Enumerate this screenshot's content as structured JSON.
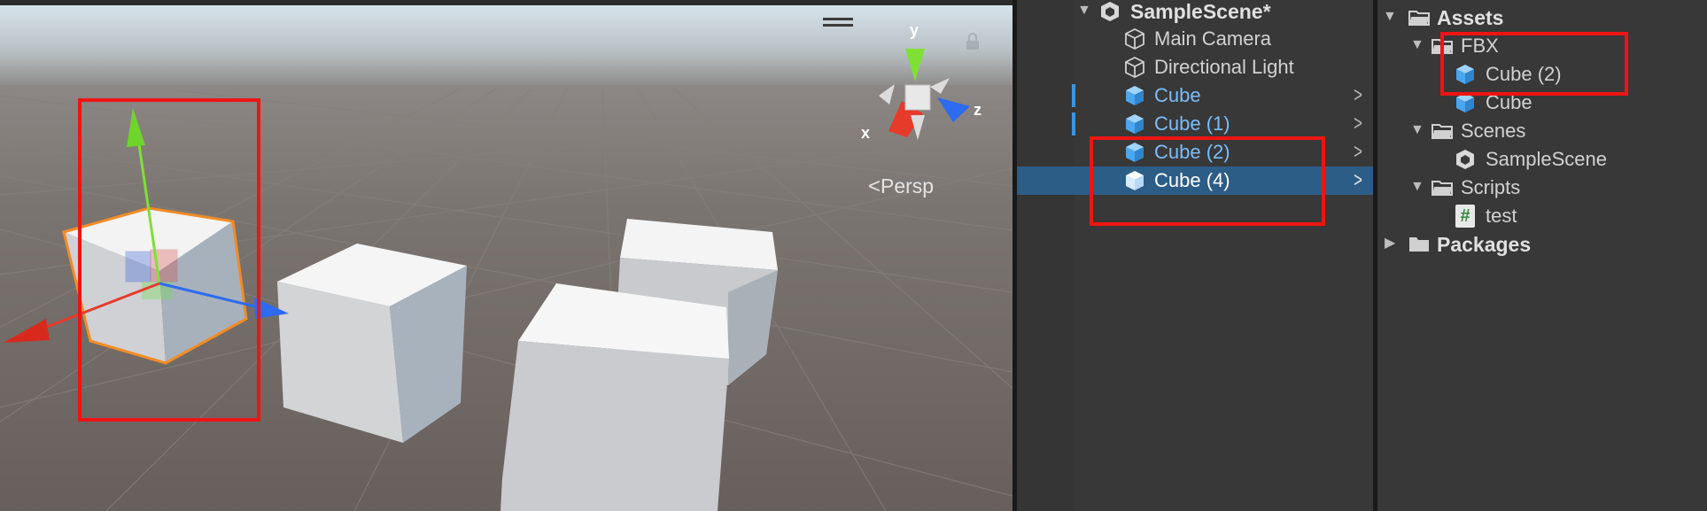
{
  "colors": {
    "panel_bg": "#383838",
    "selection": "#2c5d87",
    "prefab_text": "#7cbdf7",
    "annotation": "#ef1414",
    "axis_x": "#e63a2a",
    "axis_y": "#7ee034",
    "axis_z": "#2d6bf0"
  },
  "scene_view": {
    "camera_mode": "Persp",
    "gizmo_axes": {
      "x": "x",
      "y": "y",
      "z": "z"
    },
    "icons": [
      "hamburger-icon",
      "lock-icon",
      "scene-gizmo-icon",
      "move-tool-icon"
    ]
  },
  "hierarchy": {
    "scene_name": "SampleScene*",
    "items": [
      {
        "label": "Main Camera",
        "icon": "gameobject-icon",
        "prefab": false,
        "selected": false
      },
      {
        "label": "Directional Light",
        "icon": "gameobject-icon",
        "prefab": false,
        "selected": false
      },
      {
        "label": "Cube",
        "icon": "prefab-icon",
        "prefab": true,
        "selected": false
      },
      {
        "label": "Cube (1)",
        "icon": "prefab-icon",
        "prefab": true,
        "selected": false
      },
      {
        "label": "Cube (2)",
        "icon": "prefab-icon",
        "prefab": true,
        "selected": false
      },
      {
        "label": "Cube (4)",
        "icon": "prefab-icon",
        "prefab": true,
        "selected": true
      }
    ]
  },
  "project": {
    "tree": [
      {
        "label": "Assets",
        "type": "folder",
        "bold": true
      },
      {
        "label": "FBX",
        "type": "folder"
      },
      {
        "label": "Cube (2)",
        "type": "prefab"
      },
      {
        "label": "Cube",
        "type": "prefab"
      },
      {
        "label": "Scenes",
        "type": "folder"
      },
      {
        "label": "SampleScene",
        "type": "scene"
      },
      {
        "label": "Scripts",
        "type": "folder"
      },
      {
        "label": "test",
        "type": "script",
        "glyph": "#"
      },
      {
        "label": "Packages",
        "type": "folder",
        "bold": true
      }
    ]
  }
}
